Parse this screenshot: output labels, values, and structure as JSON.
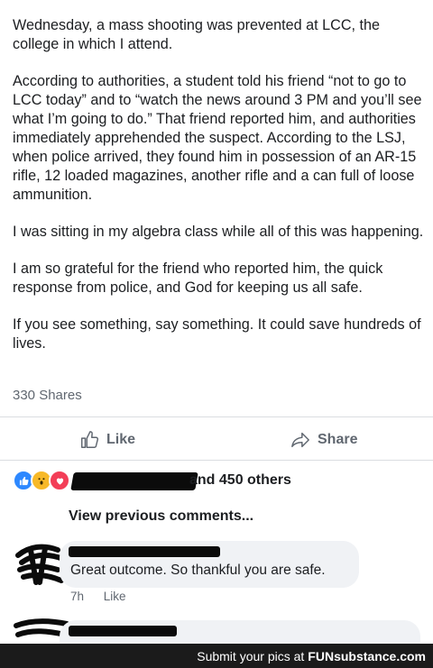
{
  "post": {
    "paragraphs": [
      "Wednesday, a mass shooting was prevented at LCC, the college in which I attend.",
      "According to authorities, a student told his friend “not to go to LCC today” and to “watch the news around 3 PM and you’ll see what I’m going to do.” That friend reported him, and authorities immediately apprehended the suspect. According to the LSJ, when police arrived, they found him in possession of an AR-15 rifle, 12 loaded magazines, another rifle and a can full of loose ammunition.",
      "I was sitting in my algebra class while all of this was happening.",
      "I am so grateful for the friend who reported him, the quick response from police, and God for keeping us all safe.",
      "If you see something, say something. It could save hundreds of lives."
    ],
    "shares": "330 Shares"
  },
  "actions": {
    "like_label": "Like",
    "share_label": "Share"
  },
  "reactions": {
    "icons": [
      "like-reaction",
      "wow-reaction",
      "love-reaction"
    ],
    "colors": {
      "like": "#2d88ff",
      "wow": "#f7b928",
      "love": "#f33e58"
    },
    "others_text": "and 450 others"
  },
  "comments": {
    "view_previous": "View previous comments...",
    "items": [
      {
        "text": "Great outcome. So thankful you are safe.",
        "time": "7h",
        "like_label": "Like"
      }
    ]
  },
  "footer": {
    "prefix": "Submit your pics at",
    "brand": "FUNsubstance.com"
  }
}
